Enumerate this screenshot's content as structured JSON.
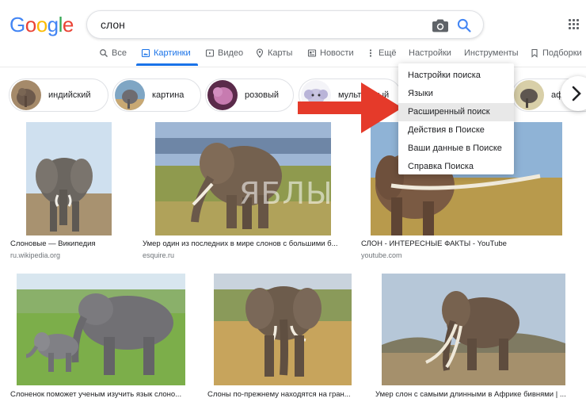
{
  "logo": {
    "letters": [
      "G",
      "o",
      "o",
      "g",
      "l",
      "e"
    ],
    "colors": [
      "#4285f4",
      "#ea4335",
      "#fbbc05",
      "#4285f4",
      "#34a853",
      "#ea4335"
    ]
  },
  "search": {
    "query": "слон"
  },
  "tabs": [
    {
      "label": "Все",
      "icon": "search-icon"
    },
    {
      "label": "Картинки",
      "icon": "image-icon",
      "active": true
    },
    {
      "label": "Видео",
      "icon": "video-icon"
    },
    {
      "label": "Карты",
      "icon": "map-pin-icon"
    },
    {
      "label": "Новости",
      "icon": "news-icon"
    },
    {
      "label": "Ещё",
      "icon": "more-vertical-icon"
    },
    {
      "label": "Настройки"
    },
    {
      "label": "Инструменты"
    },
    {
      "label": "Подборки",
      "icon": "bookmark-icon"
    }
  ],
  "chips": [
    {
      "label": "индийский"
    },
    {
      "label": "картина"
    },
    {
      "label": "розовый"
    },
    {
      "label": "мультяшный"
    },
    {
      "label": "африканский"
    }
  ],
  "menu": {
    "items": [
      "Настройки поиска",
      "Языки",
      "Расширенный поиск",
      "Действия в Поиске",
      "Ваши данные в Поиске",
      "Справка Поиска"
    ],
    "highlighted_index": 2
  },
  "results": [
    {
      "caption": "Слоновые — Википедия",
      "source": "ru.wikipedia.org"
    },
    {
      "caption": "Умер один из последних в мире слонов с большими б...",
      "source": "esquire.ru"
    },
    {
      "caption": "СЛОН - ИНТЕРЕСНЫЕ ФАКТЫ - YouTube",
      "source": "youtube.com"
    },
    {
      "caption": "Слоненок поможет ученым изучить язык слоно...",
      "source": ""
    },
    {
      "caption": "Слоны по-прежнему находятся на гран...",
      "source": ""
    },
    {
      "caption": "Умер слон с самыми длинными в Африке бивнями | ...",
      "source": ""
    }
  ],
  "watermark": {
    "text": "ЯБЛЫК"
  },
  "colors": {
    "accent": "#1a73e8",
    "arrow": "#e53a2a"
  }
}
